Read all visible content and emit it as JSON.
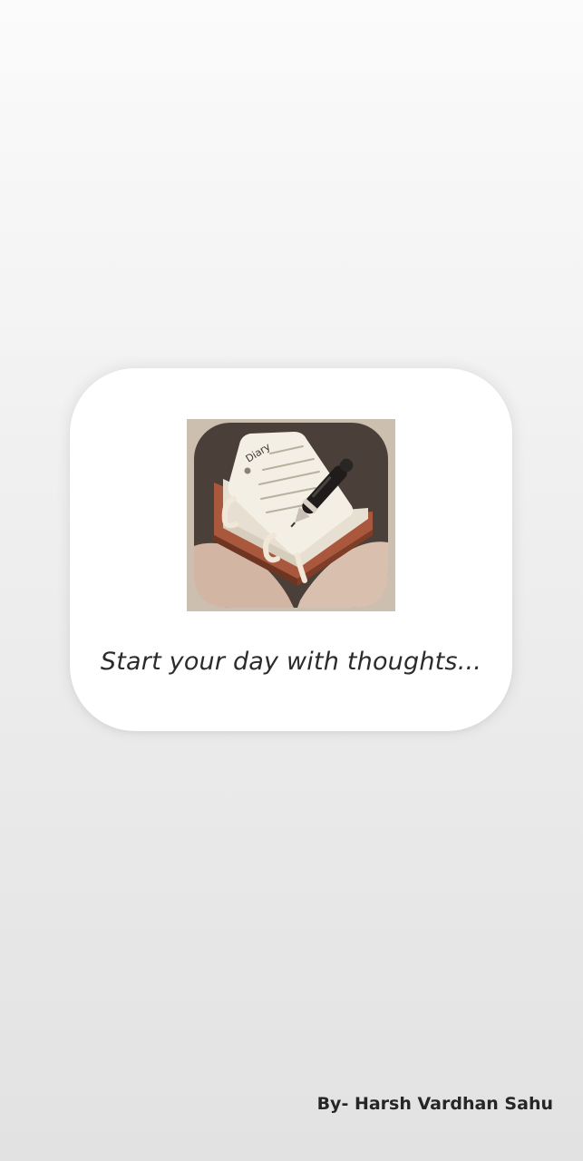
{
  "splash": {
    "logo_icon": "diary-app-icon",
    "logo_text": "Diary",
    "tagline": "Start your day with thoughts...",
    "credit": "By- Harsh Vardhan Sahu"
  },
  "colors": {
    "card_background": "#ffffff",
    "icon_dark": "#4a3f38",
    "icon_cover": "#a9573d",
    "icon_page": "#f3efe4",
    "text": "#2b2b2b"
  }
}
